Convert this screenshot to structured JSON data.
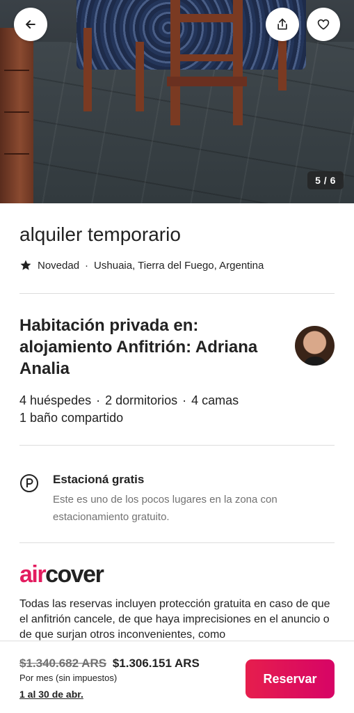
{
  "photo": {
    "counter": "5 / 6",
    "back_icon": "arrow-left-icon",
    "share_icon": "share-icon",
    "favorite_icon": "heart-icon"
  },
  "listing": {
    "title": "alquiler temporario",
    "rating_icon": "star-icon",
    "rating_label": "Novedad",
    "separator": "·",
    "location": "Ushuaia, Tierra del Fuego, Argentina"
  },
  "room": {
    "title": "Habitación privada en: alojamiento Anfitrión: Adriana Analia",
    "guests": "4 huéspedes",
    "bedrooms": "2 dormitorios",
    "beds": "4 camas",
    "bathroom": "1 baño compartido"
  },
  "amenity": {
    "icon": "parking-icon",
    "title": "Estacioná gratis",
    "description": "Este es uno de los pocos lugares en la zona con estacionamiento gratuito."
  },
  "aircover": {
    "logo_air": "air",
    "logo_cover": "cover",
    "text": "Todas las reservas incluyen protección gratuita en caso de que el anfitrión cancele, de que haya imprecisiones en el anuncio o de que surjan otros inconvenientes, como"
  },
  "booking": {
    "old_price": "$1.340.682 ARS",
    "new_price": "$1.306.151 ARS",
    "period": "Por mes (sin impuestos)",
    "dates": "1 al 30 de abr.",
    "reserve_label": "Reservar"
  },
  "colors": {
    "brand": "#e31c5f",
    "text": "#222222",
    "muted": "#717171",
    "divider": "#dddddd"
  }
}
